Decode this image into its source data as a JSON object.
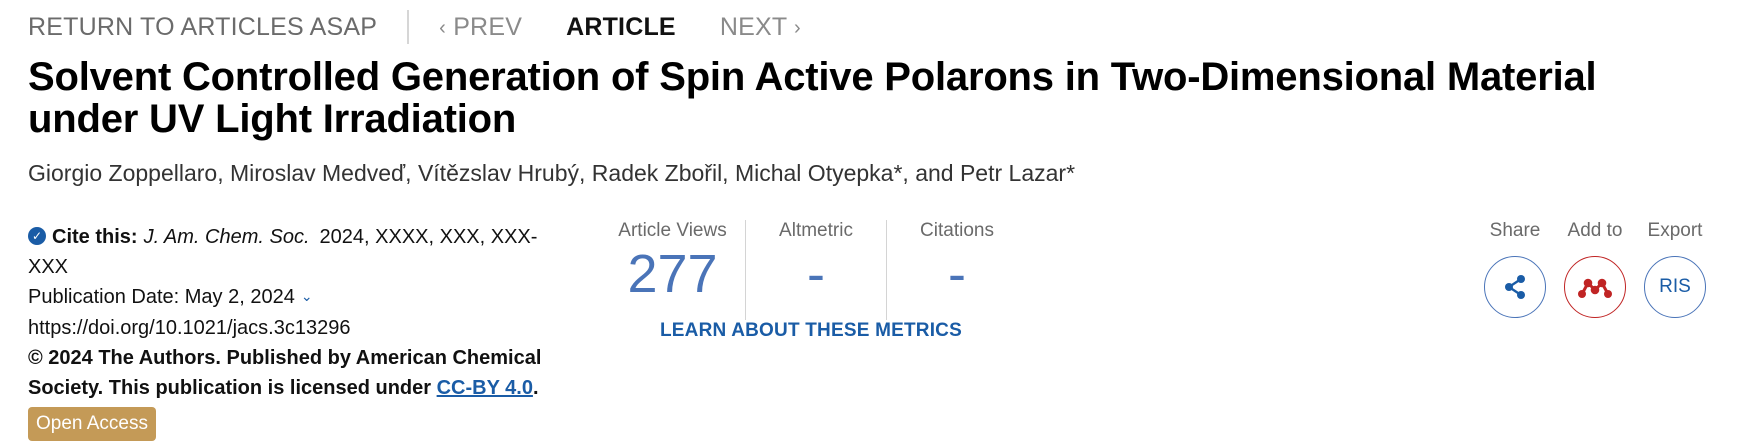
{
  "nav": {
    "return_label": "RETURN TO ARTICLES ASAP",
    "prev_label": "PREV",
    "article_label": "ARTICLE",
    "next_label": "NEXT"
  },
  "article": {
    "title": "Solvent Controlled Generation of Spin Active Polarons in Two-Dimensional Material under UV Light Irradiation",
    "authors": "Giorgio Zoppellaro, Miroslav Medveď, Vítězslav Hrubý, Radek Zbořil, Michal Otyepka*, and Petr Lazar*"
  },
  "citation": {
    "cite_label": "Cite this:",
    "journal": "J. Am. Chem. Soc.",
    "ref": "2024, XXXX, XXX, XXX-XXX",
    "pub_date": "Publication Date: May 2, 2024",
    "doi": "https://doi.org/10.1021/jacs.3c13296",
    "copyright": "© 2024 The Authors. Published by American Chemical Society. This publication is licensed under",
    "license_link": "CC-BY 4.0",
    "period": ".",
    "open_access": "Open Access"
  },
  "metrics": {
    "views_label": "Article Views",
    "views_value": "277",
    "altmetric_label": "Altmetric",
    "altmetric_value": "-",
    "citations_label": "Citations",
    "citations_value": "-",
    "learn_label": "LEARN ABOUT THESE METRICS"
  },
  "actions": {
    "share_label": "Share",
    "addto_label": "Add to",
    "export_label": "Export",
    "export_button": "RIS"
  },
  "colors": {
    "accent": "#1a5ca6",
    "metric_blue": "#4a74b8",
    "open_access": "#c49a57",
    "mendeley_red": "#c02424"
  }
}
